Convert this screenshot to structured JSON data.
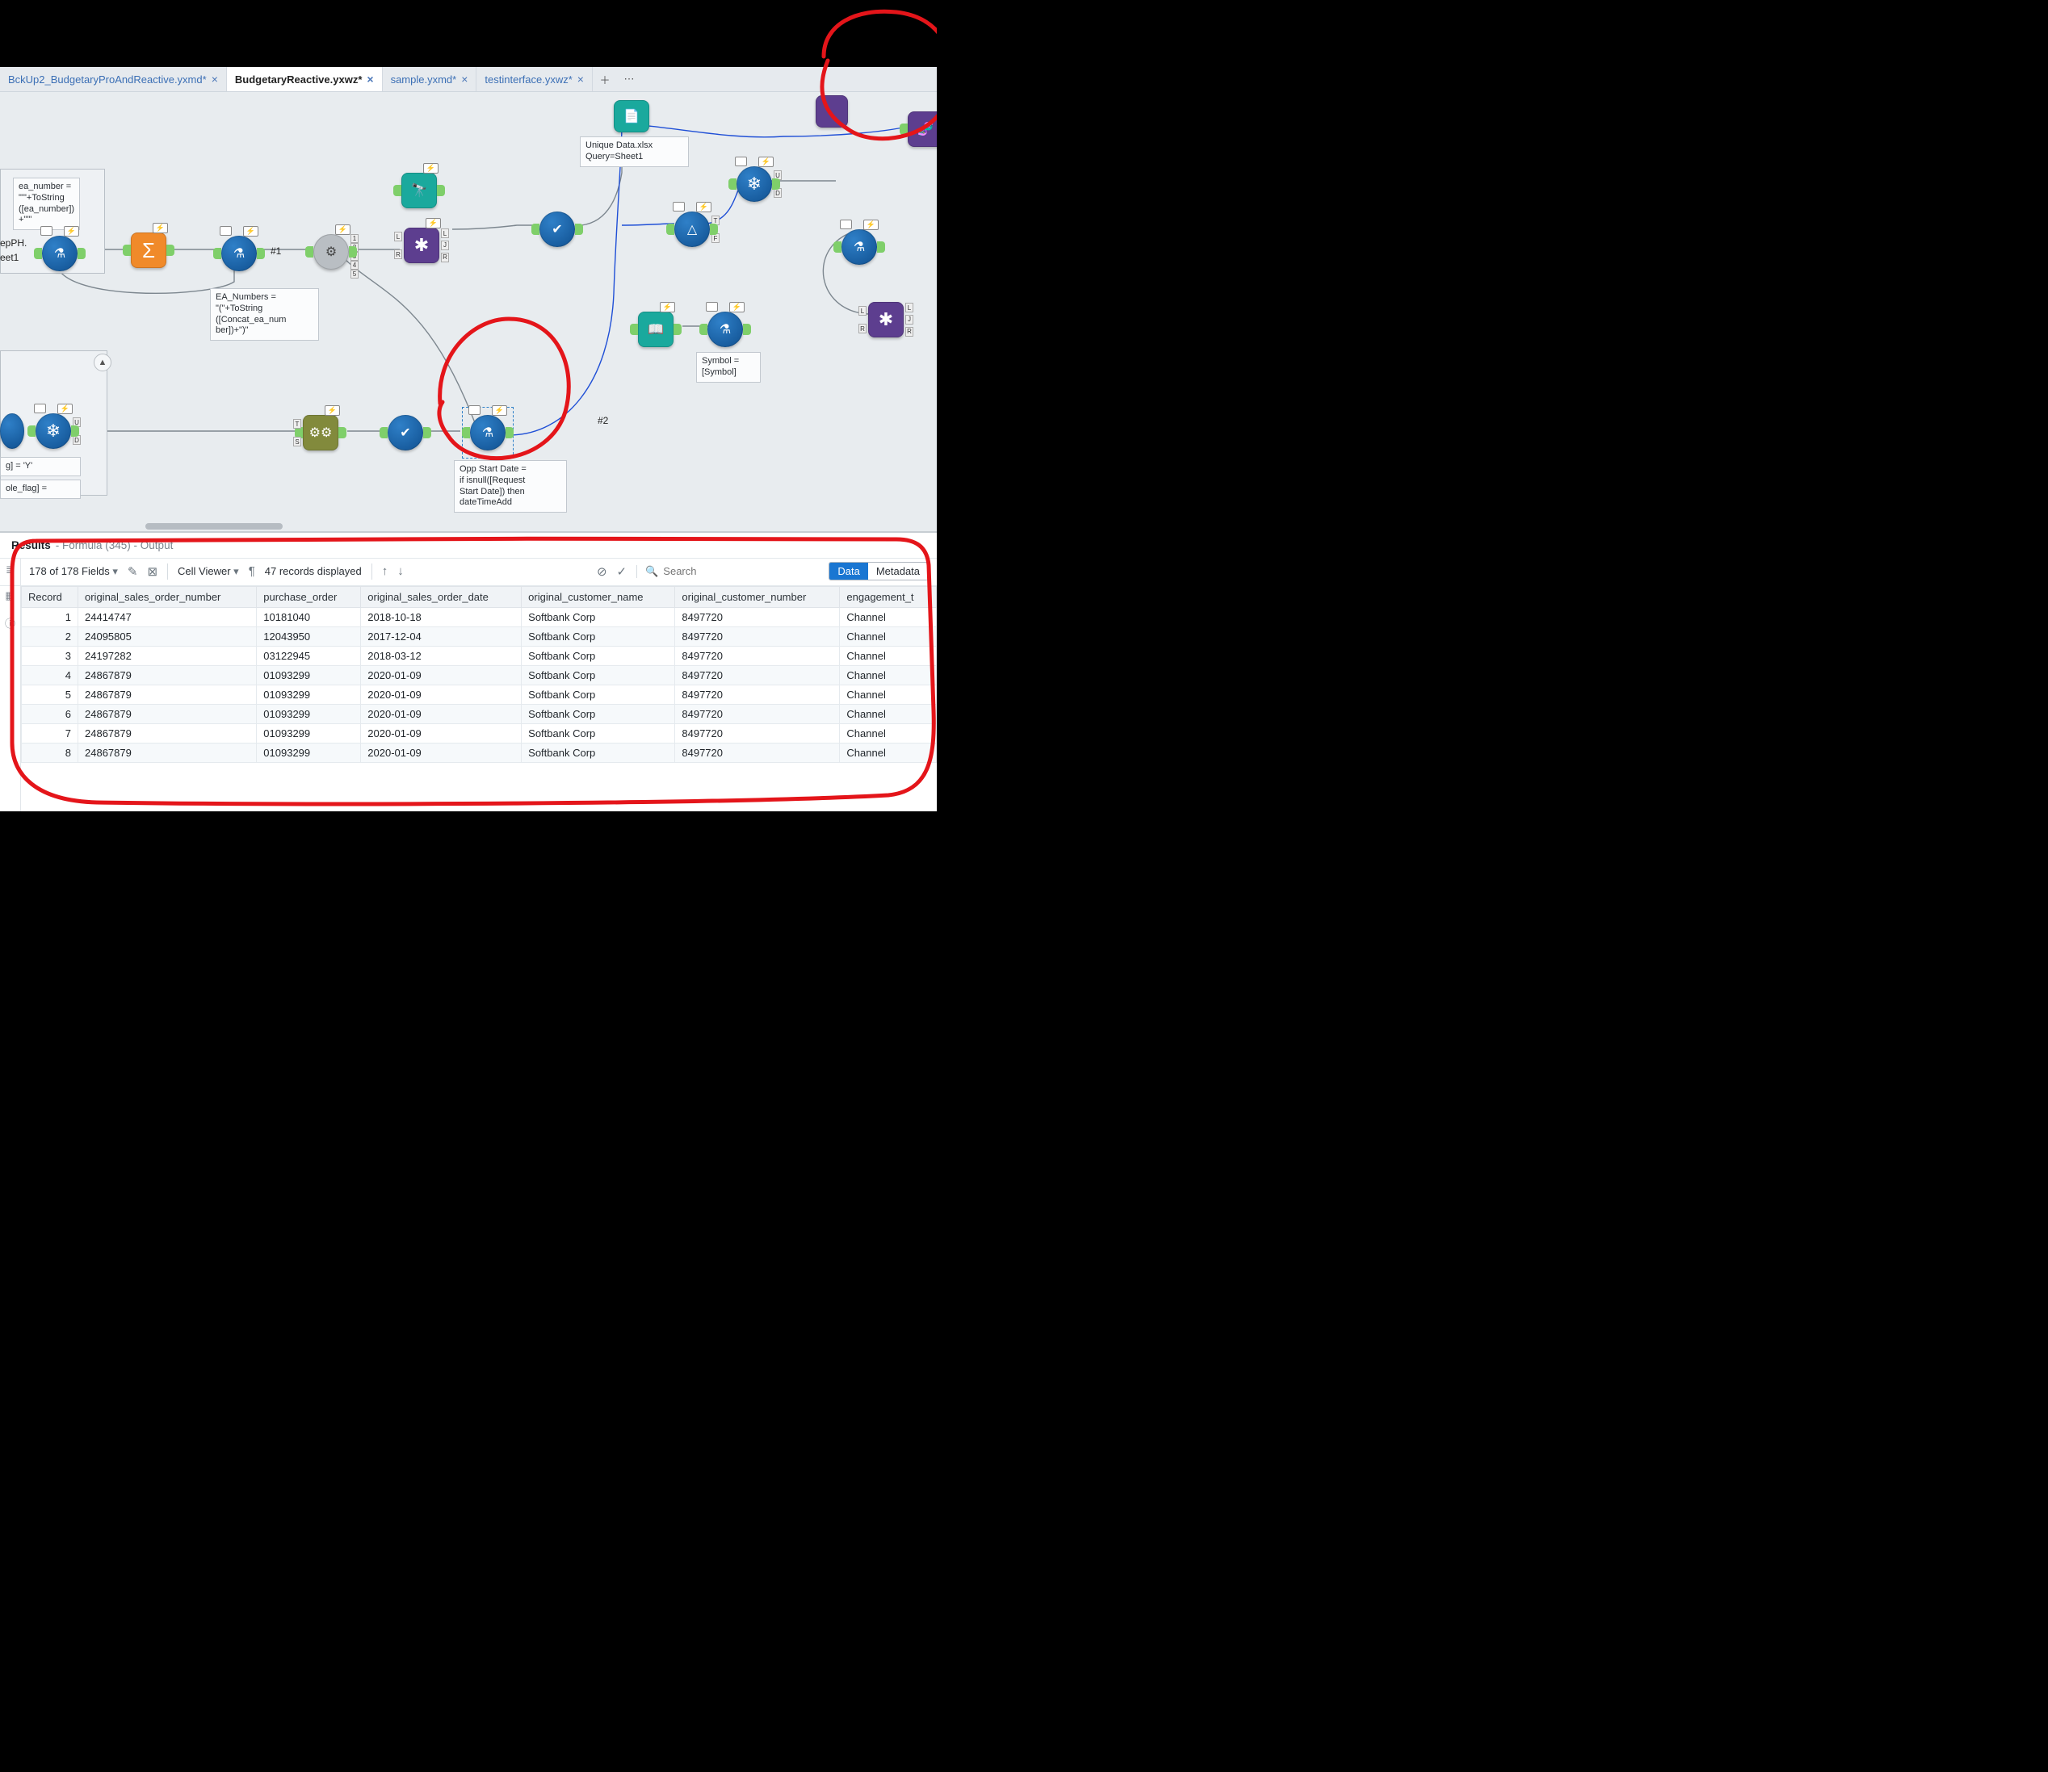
{
  "tabs": [
    {
      "label": "BckUp2_BudgetaryProAndReactive.yxmd*",
      "active": false
    },
    {
      "label": "BudgetaryReactive.yxwz*",
      "active": true
    },
    {
      "label": "sample.yxmd*",
      "active": false
    },
    {
      "label": "testinterface.yxwz*",
      "active": false
    }
  ],
  "annotations": {
    "ea_number": "ea_number =\n\"'\"+ToString\n([ea_number])\n+\"'\"",
    "epPH": "epPH.",
    "eet1": "eet1",
    "ea_numbers": "EA_Numbers =\n\"(\"+ToString\n([Concat_ea_num\nber])+\")\"",
    "unique_data": "Unique Data.xlsx\nQuery=Sheet1",
    "symbol": "Symbol =\n[Symbol]",
    "opp_start": "Opp Start Date =\nif isnull([Request\nStart Date]) then\ndateTimeAdd",
    "gY": "g] = 'Y'",
    "flag": "ole_flag] =",
    "hash1": "#1",
    "hash2": "#2"
  },
  "results": {
    "title": "Results",
    "subtitle": "- Formula (345) - Output",
    "fields_text": "178 of 178 Fields",
    "cell_viewer": "Cell Viewer",
    "records_text": "47 records displayed",
    "search_placeholder": "Search",
    "toggle_data": "Data",
    "toggle_meta": "Metadata",
    "columns": [
      "Record",
      "original_sales_order_number",
      "purchase_order",
      "original_sales_order_date",
      "original_customer_name",
      "original_customer_number",
      "engagement_t"
    ],
    "rows": [
      [
        "1",
        "24414747",
        "10181040",
        "2018-10-18",
        "Softbank Corp",
        "8497720",
        "Channel"
      ],
      [
        "2",
        "24095805",
        "12043950",
        "2017-12-04",
        "Softbank Corp",
        "8497720",
        "Channel"
      ],
      [
        "3",
        "24197282",
        "03122945",
        "2018-03-12",
        "Softbank Corp",
        "8497720",
        "Channel"
      ],
      [
        "4",
        "24867879",
        "01093299",
        "2020-01-09",
        "Softbank Corp",
        "8497720",
        "Channel"
      ],
      [
        "5",
        "24867879",
        "01093299",
        "2020-01-09",
        "Softbank Corp",
        "8497720",
        "Channel"
      ],
      [
        "6",
        "24867879",
        "01093299",
        "2020-01-09",
        "Softbank Corp",
        "8497720",
        "Channel"
      ],
      [
        "7",
        "24867879",
        "01093299",
        "2020-01-09",
        "Softbank Corp",
        "8497720",
        "Channel"
      ],
      [
        "8",
        "24867879",
        "01093299",
        "2020-01-09",
        "Softbank Corp",
        "8497720",
        "Channel"
      ]
    ]
  },
  "icons": {
    "formula": "⚗",
    "summarize": "Σ",
    "python": "⚙",
    "join": "✱",
    "find": "🔭",
    "select": "✔",
    "filter": "△",
    "snowflake": "❄",
    "input": "📄",
    "book": "📖",
    "dna": "🧬",
    "gears": "⚙⚙"
  }
}
